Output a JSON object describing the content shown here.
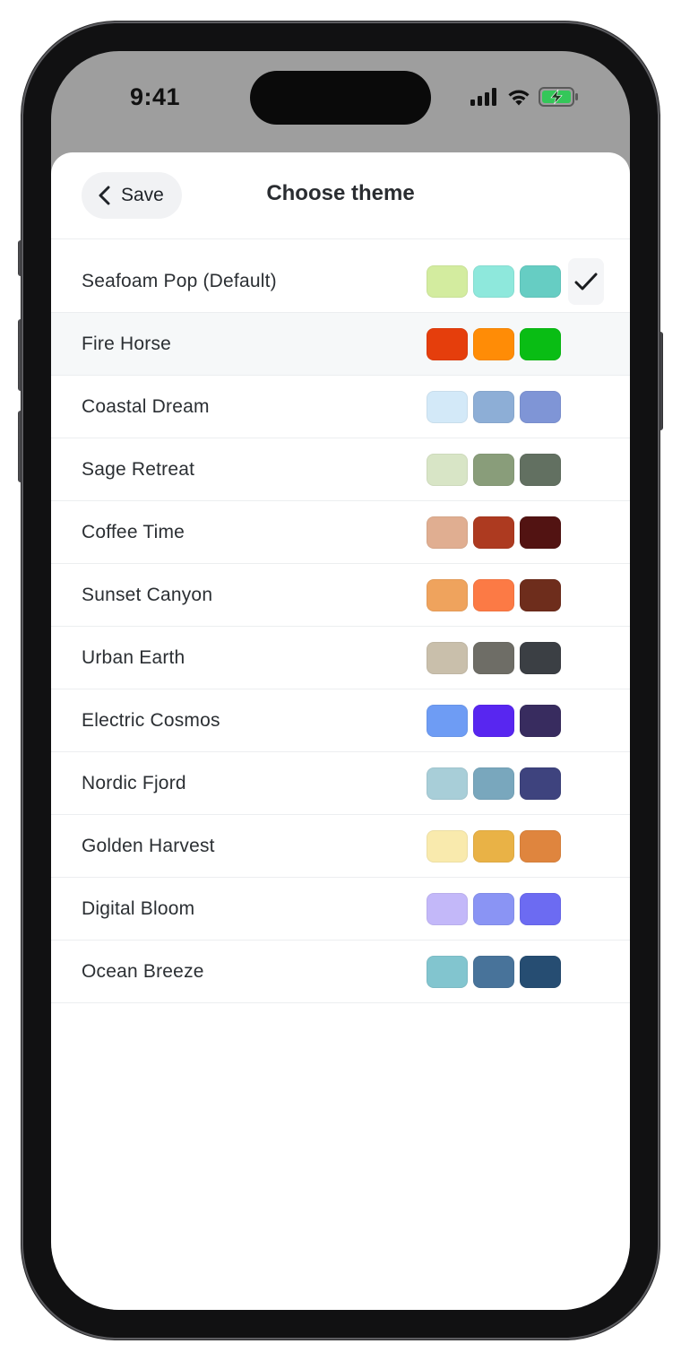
{
  "status_bar": {
    "time": "9:41"
  },
  "header": {
    "back_label": "Save",
    "title": "Choose theme"
  },
  "selected_theme": "Seafoam Pop (Default)",
  "highlighted_theme": "Fire Horse",
  "themes": [
    {
      "label": "Seafoam Pop (Default)",
      "colors": [
        "#d3ec9f",
        "#8ee8dc",
        "#66cdc3"
      ]
    },
    {
      "label": "Fire Horse",
      "colors": [
        "#e53e0c",
        "#ff8c06",
        "#09bd14"
      ]
    },
    {
      "label": "Coastal Dream",
      "colors": [
        "#d3e9f8",
        "#8daed6",
        "#7f95d6"
      ]
    },
    {
      "label": "Sage Retreat",
      "colors": [
        "#d8e5c6",
        "#899d7a",
        "#627061"
      ]
    },
    {
      "label": "Coffee Time",
      "colors": [
        "#e0ae91",
        "#ad3a20",
        "#521312"
      ]
    },
    {
      "label": "Sunset Canyon",
      "colors": [
        "#efa35d",
        "#fc7a45",
        "#6e2d1c"
      ]
    },
    {
      "label": "Urban Earth",
      "colors": [
        "#c9bfab",
        "#6e6d66",
        "#3b3f44"
      ]
    },
    {
      "label": "Electric Cosmos",
      "colors": [
        "#6e9cf4",
        "#5826f0",
        "#382c5f"
      ]
    },
    {
      "label": "Nordic Fjord",
      "colors": [
        "#a8ced8",
        "#79a7bd",
        "#3e437e"
      ]
    },
    {
      "label": "Golden Harvest",
      "colors": [
        "#f9eaad",
        "#e9b246",
        "#df853e"
      ]
    },
    {
      "label": "Digital Bloom",
      "colors": [
        "#c3b8f9",
        "#8a94f4",
        "#6c6bf2"
      ]
    },
    {
      "label": "Ocean Breeze",
      "colors": [
        "#82c5cf",
        "#48739a",
        "#264d72"
      ]
    }
  ],
  "icons": {
    "back": "chevron-left-icon",
    "selected": "checkmark-icon",
    "signal": "cellular-signal-icon",
    "wifi": "wifi-icon",
    "battery": "battery-charging-icon"
  }
}
